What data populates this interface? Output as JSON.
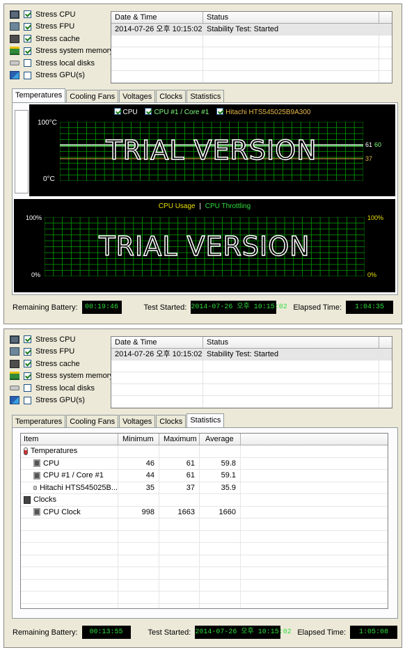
{
  "panels": [
    {
      "options": [
        {
          "label": "Stress CPU",
          "checked": true,
          "icon": "cpu-icon"
        },
        {
          "label": "Stress FPU",
          "checked": true,
          "icon": "fpu-icon"
        },
        {
          "label": "Stress cache",
          "checked": true,
          "icon": "cache-icon"
        },
        {
          "label": "Stress system memory",
          "checked": true,
          "icon": "memory-icon"
        },
        {
          "label": "Stress local disks",
          "checked": false,
          "icon": "disk-icon"
        },
        {
          "label": "Stress GPU(s)",
          "checked": false,
          "icon": "gpu-icon"
        }
      ],
      "log": {
        "headers": [
          "Date & Time",
          "Status"
        ],
        "rows": [
          {
            "datetime": "2014-07-26 오후 10:15:02",
            "status": "Stability Test: Started"
          }
        ]
      },
      "tabs": [
        "Temperatures",
        "Cooling Fans",
        "Voltages",
        "Clocks",
        "Statistics"
      ],
      "active_tab": 0,
      "temp_chart": {
        "legend": [
          "CPU",
          "CPU #1 / Core #1",
          "Hitachi HTS545025B9A300"
        ],
        "y_top": "100°C",
        "y_bottom": "0°C",
        "watermark": "TRIAL VERSION",
        "val_a": "61",
        "val_b": "60",
        "val_c": "37"
      },
      "usage_chart": {
        "legend_a": "CPU Usage",
        "legend_sep": "|",
        "legend_b": "CPU Throttling",
        "y_top_left": "100%",
        "y_bottom_left": "0%",
        "y_top_right": "100%",
        "y_bottom_right": "0%",
        "watermark": "TRIAL VERSION"
      },
      "status": {
        "battery_label": "Remaining Battery:",
        "battery": "00:19:46",
        "started_label": "Test Started:",
        "started": "2014-07-26 오후 10:15:02",
        "elapsed_label": "Elapsed Time:",
        "elapsed": "1:04:35"
      }
    },
    {
      "options": [
        {
          "label": "Stress CPU",
          "checked": true,
          "icon": "cpu-icon"
        },
        {
          "label": "Stress FPU",
          "checked": true,
          "icon": "fpu-icon"
        },
        {
          "label": "Stress cache",
          "checked": true,
          "icon": "cache-icon"
        },
        {
          "label": "Stress system memory",
          "checked": true,
          "icon": "memory-icon"
        },
        {
          "label": "Stress local disks",
          "checked": false,
          "icon": "disk-icon"
        },
        {
          "label": "Stress GPU(s)",
          "checked": false,
          "icon": "gpu-icon"
        }
      ],
      "log": {
        "headers": [
          "Date & Time",
          "Status"
        ],
        "rows": [
          {
            "datetime": "2014-07-26 오후 10:15:02",
            "status": "Stability Test: Started"
          }
        ]
      },
      "tabs": [
        "Temperatures",
        "Cooling Fans",
        "Voltages",
        "Clocks",
        "Statistics"
      ],
      "active_tab": 4,
      "stats": {
        "headers": [
          "Item",
          "Minimum",
          "Maximum",
          "Average"
        ],
        "rows": [
          {
            "item": "Temperatures",
            "min": "",
            "max": "",
            "avg": "",
            "level": 1,
            "icon": "thermometer-icon"
          },
          {
            "item": "CPU",
            "min": "46",
            "max": "61",
            "avg": "59.8",
            "level": 2,
            "icon": "chip-icon"
          },
          {
            "item": "CPU #1 / Core #1",
            "min": "44",
            "max": "61",
            "avg": "59.1",
            "level": 2,
            "icon": "chip-icon"
          },
          {
            "item": "Hitachi HTS545025B...",
            "min": "35",
            "max": "37",
            "avg": "35.9",
            "level": 2,
            "icon": "disk-icon"
          },
          {
            "item": "Clocks",
            "min": "",
            "max": "",
            "avg": "",
            "level": 1,
            "icon": "clock-icon"
          },
          {
            "item": "CPU Clock",
            "min": "998",
            "max": "1663",
            "avg": "1660",
            "level": 2,
            "icon": "chip-icon"
          }
        ]
      },
      "status": {
        "battery_label": "Remaining Battery:",
        "battery": "00:13:55",
        "started_label": "Test Started:",
        "started": "2014-07-26 오후 10:15:02",
        "elapsed_label": "Elapsed Time:",
        "elapsed": "1:05:08"
      }
    }
  ],
  "colors": {
    "chart_bg": "#000000",
    "grid": "#00a000",
    "cpu_line": "#ffffff",
    "core_line": "#7fff7f",
    "disk_line": "#e8b94a",
    "usage_text": "#e8e000",
    "status_text": "#2fdc3c"
  }
}
